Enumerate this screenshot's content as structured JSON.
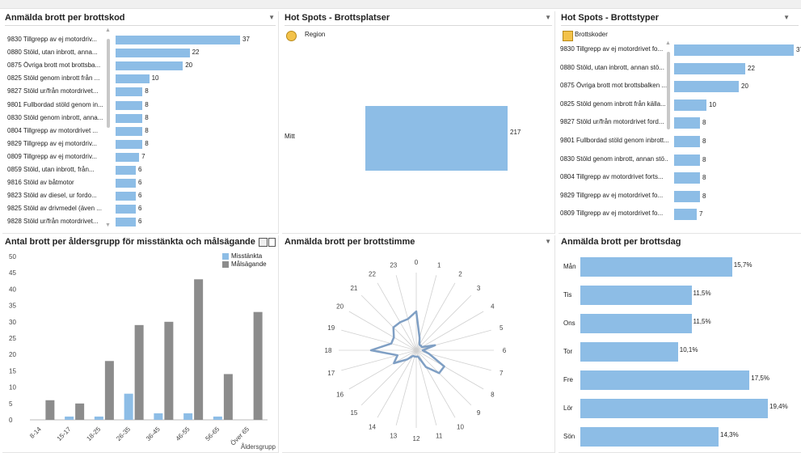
{
  "colors": {
    "blue": "#8dbde6",
    "gray": "#8c8c8c",
    "radar": "#7f9fc4"
  },
  "panel1": {
    "title": "Anmälda brott per brottskod",
    "rows": [
      {
        "label": "9830 Tillgrepp av ej motordriv...",
        "value": 37
      },
      {
        "label": "0880 Stöld, utan inbrott, anna...",
        "value": 22
      },
      {
        "label": "0875 Övriga brott mot brottsba...",
        "value": 20
      },
      {
        "label": "0825 Stöld genom inbrott från ...",
        "value": 10
      },
      {
        "label": "9827 Stöld ur/från motordrivet...",
        "value": 8
      },
      {
        "label": "9801 Fullbordad stöld genom in...",
        "value": 8
      },
      {
        "label": "0830 Stöld genom inbrott, anna...",
        "value": 8
      },
      {
        "label": "0804 Tillgrepp av motordrivet ...",
        "value": 8
      },
      {
        "label": "9829 Tillgrepp av ej motordriv...",
        "value": 8
      },
      {
        "label": "0809 Tillgrepp av ej motordriv...",
        "value": 7
      },
      {
        "label": "0859 Stöld, utan inbrott, från...",
        "value": 6
      },
      {
        "label": "9816 Stöld av båtmotor",
        "value": 6
      },
      {
        "label": "9823 Stöld av diesel, ur fordo...",
        "value": 6
      },
      {
        "label": "9825 Stöld av drivmedel (även ...",
        "value": 6
      },
      {
        "label": "9828 Stöld ur/från motordrivet...",
        "value": 6
      }
    ]
  },
  "panel2": {
    "title": "Hot Spots - Brottsplatser",
    "header": "Region",
    "rows": [
      {
        "label": "Mitt",
        "value": 217
      }
    ]
  },
  "panel3": {
    "title": "Hot Spots - Brottstyper",
    "header": "Brottskoder",
    "rows": [
      {
        "label": "9830 Tillgrepp av ej motordrivet fo...",
        "value": 37
      },
      {
        "label": "0880 Stöld, utan inbrott, annan stö...",
        "value": 22
      },
      {
        "label": "0875 Övriga brott mot brottsbalken ...",
        "value": 20
      },
      {
        "label": "0825 Stöld genom inbrott från källa...",
        "value": 10
      },
      {
        "label": "9827 Stöld ur/från motordrivet ford...",
        "value": 8
      },
      {
        "label": "9801 Fullbordad stöld genom inbrott...",
        "value": 8
      },
      {
        "label": "0830 Stöld genom inbrott, annan stö...",
        "value": 8
      },
      {
        "label": "0804 Tillgrepp av motordrivet forts...",
        "value": 8
      },
      {
        "label": "9829 Tillgrepp av ej motordrivet fo...",
        "value": 8
      },
      {
        "label": "0809 Tillgrepp av ej motordrivet fo...",
        "value": 7
      }
    ]
  },
  "panel4": {
    "title": "Antal brott per åldersgrupp för misstänkta och målsägande"
  },
  "panel5": {
    "title": "Anmälda brott per brottstimme"
  },
  "panel6": {
    "title": "Anmälda brott per brottsdag"
  },
  "chart_data": [
    {
      "type": "bar",
      "title": "Antal brott per åldersgrupp för misstänkta och målsägande",
      "categories": [
        "8-14",
        "15-17",
        "18-25",
        "26-35",
        "36-45",
        "46-55",
        "56-65",
        "Över 65"
      ],
      "series": [
        {
          "name": "Misstänkta",
          "values": [
            0,
            1,
            1,
            8,
            2,
            2,
            1,
            0
          ]
        },
        {
          "name": "Målsägande",
          "values": [
            6,
            5,
            18,
            29,
            30,
            43,
            14,
            33
          ]
        }
      ],
      "xlabel": "Åldersgrupp",
      "ylabel": "",
      "ylim": [
        0,
        50
      ],
      "yticks": [
        0,
        5,
        10,
        15,
        20,
        25,
        30,
        35,
        40,
        45,
        50
      ],
      "legend": "top-right"
    },
    {
      "type": "radar",
      "title": "Anmälda brott per brottstimme",
      "categories": [
        "0",
        "1",
        "2",
        "3",
        "4",
        "5",
        "6",
        "7",
        "8",
        "9",
        "10",
        "11",
        "12",
        "13",
        "14",
        "15",
        "16",
        "17",
        "18",
        "19",
        "20",
        "21",
        "22",
        "23"
      ],
      "values": [
        6,
        2,
        1,
        1,
        1,
        3,
        1,
        2,
        5,
        5,
        3,
        1,
        1,
        1,
        1,
        2,
        4,
        3,
        7,
        4,
        4,
        5,
        5,
        5
      ],
      "rmax": 12
    },
    {
      "type": "bar",
      "title": "Anmälda brott per brottsdag",
      "orientation": "horizontal",
      "categories": [
        "Mån",
        "Tis",
        "Ons",
        "Tor",
        "Fre",
        "Lör",
        "Sön"
      ],
      "values": [
        15.7,
        11.5,
        11.5,
        10.1,
        17.5,
        19.4,
        14.3
      ],
      "value_labels": [
        "15,7%",
        "11,5%",
        "11,5%",
        "10,1%",
        "17,5%",
        "19,4%",
        "14,3%"
      ]
    }
  ]
}
